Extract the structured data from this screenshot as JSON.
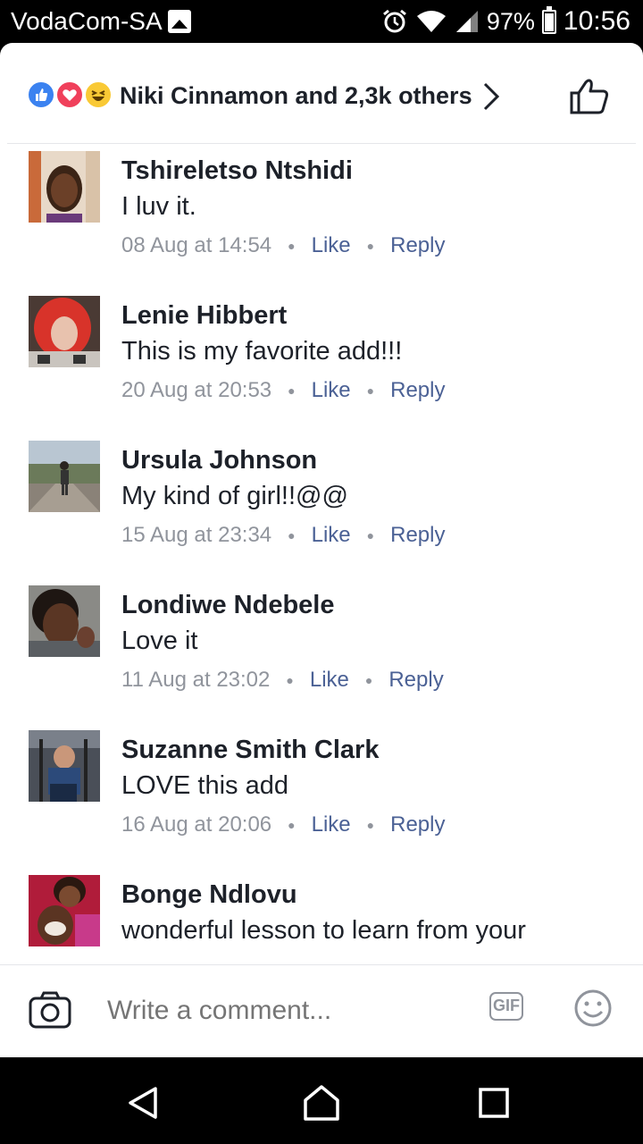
{
  "status_bar": {
    "carrier": "VodaCom-SA",
    "battery": "97%",
    "time": "10:56"
  },
  "reactions": {
    "summary": "Niki Cinnamon and 2,3k others"
  },
  "comments": [
    {
      "name": "Tshireletso Ntshidi",
      "text": "I luv it.",
      "time": "08 Aug at 14:54",
      "like": "Like",
      "reply": "Reply"
    },
    {
      "name": "Lenie Hibbert",
      "text": "This is my favorite add!!!",
      "time": "20 Aug at 20:53",
      "like": "Like",
      "reply": "Reply"
    },
    {
      "name": "Ursula Johnson",
      "text": "My kind of girl!!@@",
      "time": "15 Aug at 23:34",
      "like": "Like",
      "reply": "Reply"
    },
    {
      "name": "Londiwe Ndebele",
      "text": "Love it",
      "time": "11 Aug at 23:02",
      "like": "Like",
      "reply": "Reply"
    },
    {
      "name": "Suzanne Smith Clark",
      "text": "LOVE this add",
      "time": "16 Aug at 20:06",
      "like": "Like",
      "reply": "Reply"
    },
    {
      "name": "Bonge Ndlovu",
      "text": "wonderful lesson to learn from your",
      "time": "",
      "like": "",
      "reply": ""
    }
  ],
  "composer": {
    "placeholder": "Write a comment...",
    "gif_label": "GIF"
  }
}
